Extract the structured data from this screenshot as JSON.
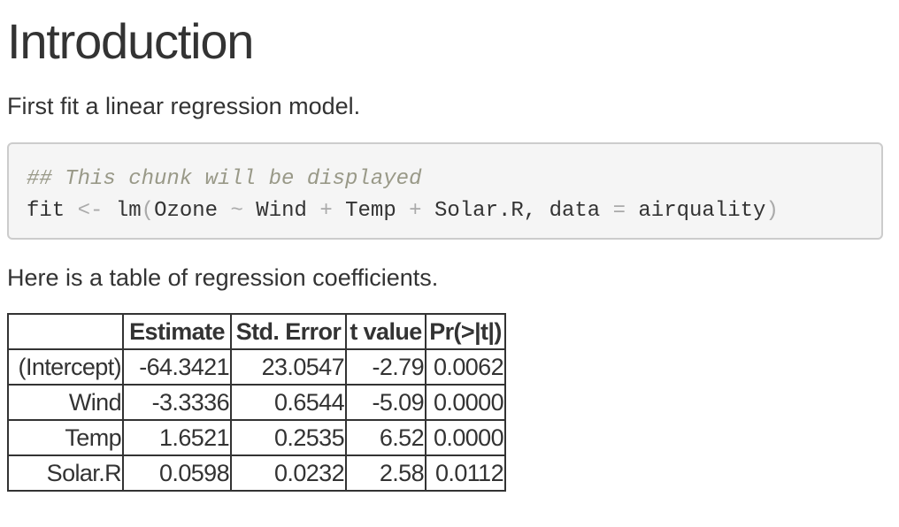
{
  "heading": "Introduction",
  "intro_text": "First fit a linear regression model.",
  "code": {
    "comment": "## This chunk will be displayed",
    "tokens": {
      "var": "fit",
      "assign": "<-",
      "func": "lm",
      "open_paren": "(",
      "arg1": "Ozone",
      "tilde": "~",
      "arg2": "Wind",
      "plus1": "+",
      "arg3": "Temp",
      "plus2": "+",
      "arg4": "Solar.R,",
      "param": "data",
      "equals": "=",
      "value": "airquality",
      "close_paren": ")"
    }
  },
  "table_intro": "Here is a table of regression coefficients.",
  "table": {
    "headers": [
      "",
      "Estimate",
      "Std. Error",
      "t value",
      "Pr(>|t|)"
    ],
    "rows": [
      [
        "(Intercept)",
        "-64.3421",
        "23.0547",
        "-2.79",
        "0.0062"
      ],
      [
        "Wind",
        "-3.3336",
        "0.6544",
        "-5.09",
        "0.0000"
      ],
      [
        "Temp",
        "1.6521",
        "0.2535",
        "6.52",
        "0.0000"
      ],
      [
        "Solar.R",
        "0.0598",
        "0.0232",
        "2.58",
        "0.0112"
      ]
    ]
  }
}
